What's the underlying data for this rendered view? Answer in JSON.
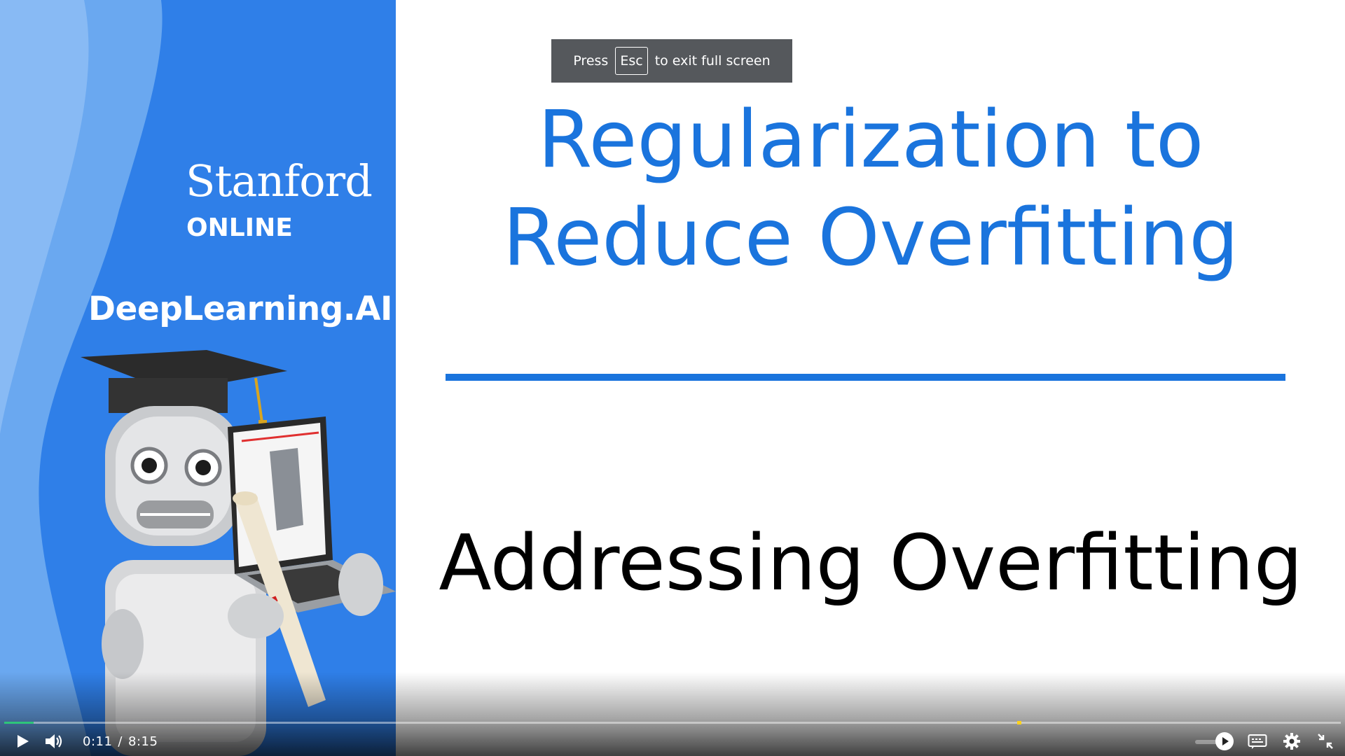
{
  "slide": {
    "brand_stanford": "Stanford",
    "brand_online": "ONLINE",
    "brand_deeplearning": "DeepLearning.AI",
    "title_line1": "Regularization to",
    "title_line2": "Reduce Overfitting",
    "subtitle": "Addressing Overfitting"
  },
  "toast": {
    "press": "Press",
    "key": "Esc",
    "message": "to exit full screen"
  },
  "player": {
    "current_time": "0:11",
    "separator": "/",
    "duration": "8:15",
    "progress_fraction": 0.022,
    "marker_fraction": 0.758,
    "icons": [
      "play-icon",
      "volume-icon",
      "speed-play-icon",
      "captions-icon",
      "settings-icon",
      "exit-fullscreen-icon"
    ]
  },
  "colors": {
    "panel_blue": "#2f7fe8",
    "title_blue": "#1a74dd",
    "progress_green": "#2ec47a",
    "marker_yellow": "#ffd21a"
  }
}
